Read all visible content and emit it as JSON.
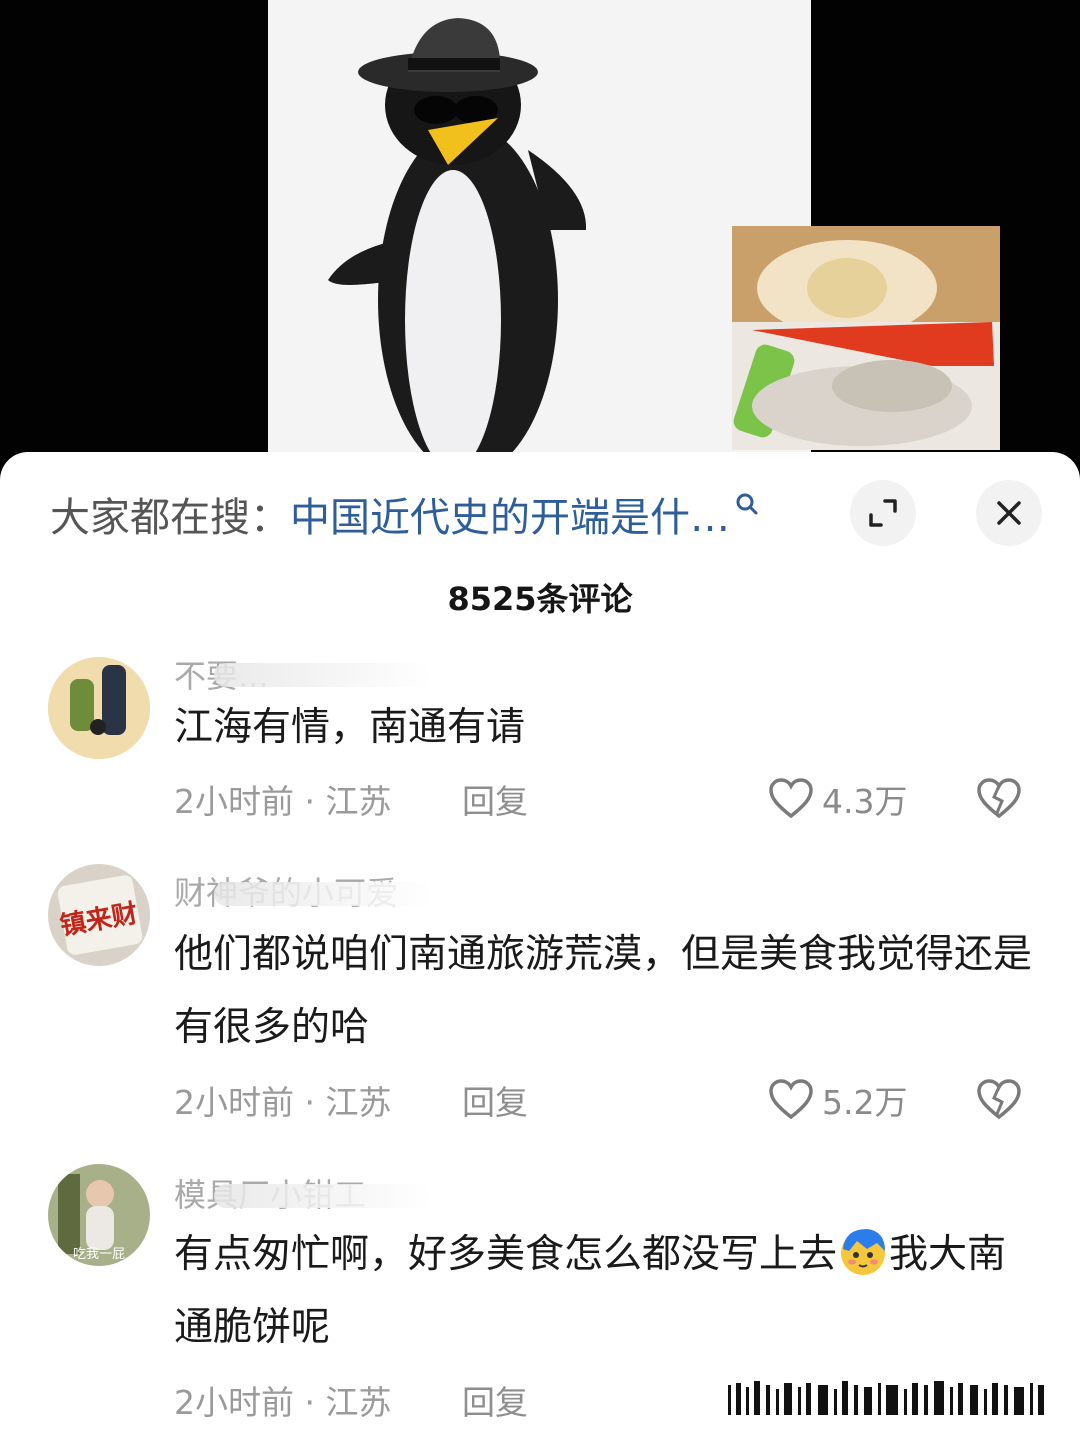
{
  "search": {
    "prefix": "大家都在搜：",
    "query": "中国近代史的开端是什…",
    "search_icon": "search-icon"
  },
  "panel": {
    "expand_icon": "expand-icon",
    "close_icon": "close-icon",
    "comment_count": "8525条评论"
  },
  "comments": [
    {
      "username": "不要...",
      "text": "江海有情，南通有请",
      "time_location": "2小时前 · 江苏",
      "reply_label": "回复",
      "likes": "4.3万"
    },
    {
      "username": "财神爷的小可爱",
      "text": "他们都说咱们南通旅游荒漠，但是美食我觉得还是有很多的哈",
      "time_location": "2小时前 · 江苏",
      "reply_label": "回复",
      "likes": "5.2万"
    },
    {
      "username": "模具厂小钳工",
      "text_before_emoji": "有点匆忙啊，好多美食怎么都没写上去",
      "text_after_emoji": "我大南通脆饼呢",
      "emoji": "blushing-face-emoji",
      "time_location": "2小时前 · 江苏",
      "reply_label": "回复"
    }
  ],
  "avatar_texts": {
    "avatar2": "镇来财",
    "avatar3": "吃我一屁"
  },
  "colors": {
    "accent_link": "#2e5e9a",
    "meta_gray": "#9a9a9a",
    "text_dark": "#1a1a1a"
  }
}
